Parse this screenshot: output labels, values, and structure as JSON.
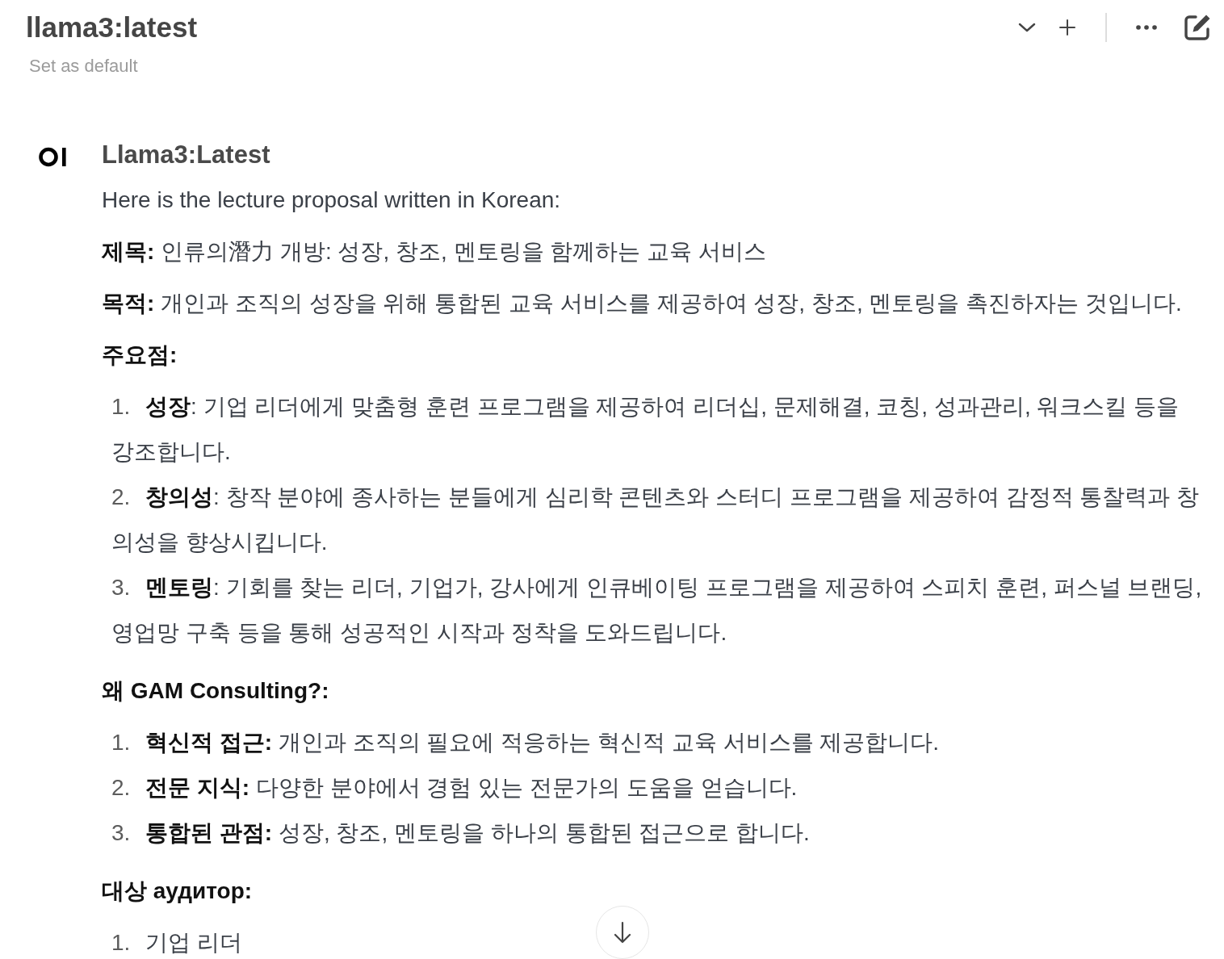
{
  "header": {
    "title": "llama3:latest",
    "subtitle": "Set as default"
  },
  "message": {
    "author": "Llama3:Latest",
    "blocks": [
      {
        "kind": "paragraph",
        "text": "Here is the lecture proposal written in Korean:"
      },
      {
        "kind": "paragraph",
        "text": "**제목:** 인류의潛力 개방: 성장, 창조, 멘토링을 함께하는 교육 서비스"
      },
      {
        "kind": "paragraph",
        "text": "**목적:** 개인과 조직의 성장을 위해 통합된 교육 서비스를 제공하여 성장, 창조, 멘토링을 촉진하자는 것입니다."
      },
      {
        "kind": "heading",
        "text": "주요점:"
      },
      {
        "kind": "list",
        "items": [
          {
            "number": "1.",
            "text": "**성장**: 기업 리더에게 맞춤형 훈련 프로그램을 제공하여 리더십, 문제해결, 코칭, 성과관리, 워크스킬 등을 강조합니다."
          },
          {
            "number": "2.",
            "text": "**창의성**: 창작 분야에 종사하는 분들에게 심리학 콘텐츠와 스터디 프로그램을 제공하여 감정적 통찰력과 창의성을 향상시킵니다."
          },
          {
            "number": "3.",
            "text": "**멘토링**: 기회를 찾는 리더, 기업가, 강사에게 인큐베이팅 프로그램을 제공하여 스피치 훈련, 퍼스널 브랜딩, 영업망 구축 등을 통해 성공적인 시작과 정착을 도와드립니다."
          }
        ]
      },
      {
        "kind": "heading",
        "text": "왜 GAM Consulting?:"
      },
      {
        "kind": "list",
        "items": [
          {
            "number": "1.",
            "text": "**혁신적 접근:** 개인과 조직의 필요에 적응하는 혁신적 교육 서비스를 제공합니다."
          },
          {
            "number": "2.",
            "text": "**전문 지식:** 다양한 분야에서 경험 있는 전문가의 도움을 얻습니다."
          },
          {
            "number": "3.",
            "text": "**통합된 관점:** 성장, 창조, 멘토링을 하나의 통합된 접근으로 합니다."
          }
        ]
      },
      {
        "kind": "heading",
        "text": "대상 аудитор:"
      },
      {
        "kind": "list",
        "items": [
          {
            "number": "1.",
            "text": "기업 리더"
          }
        ]
      }
    ]
  }
}
